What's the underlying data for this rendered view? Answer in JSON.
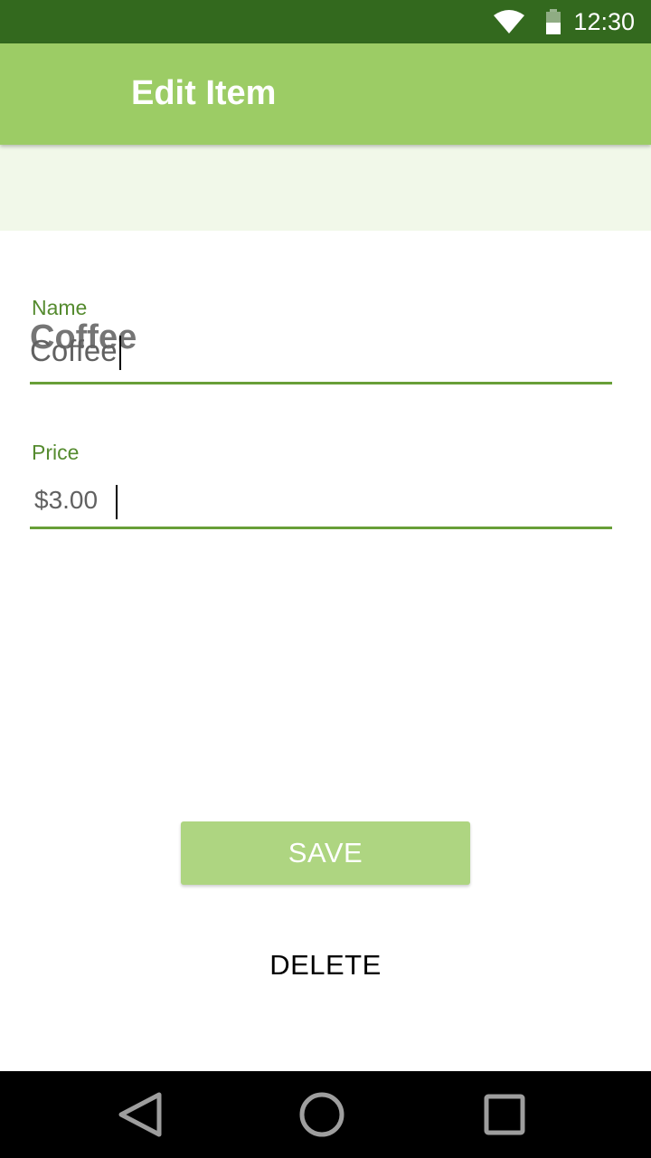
{
  "status_bar": {
    "time": "12:30",
    "icons": [
      "wifi-icon",
      "battery-icon"
    ]
  },
  "app_bar": {
    "title": "Edit Item"
  },
  "header": {
    "item_name": "Coffee"
  },
  "form": {
    "name": {
      "label": "Name",
      "value": "Coffee"
    },
    "price": {
      "label": "Price",
      "value": "$3.00"
    }
  },
  "actions": {
    "save_label": "SAVE",
    "delete_label": "DELETE"
  },
  "nav_bar": {
    "icons": [
      "back-icon",
      "home-icon",
      "recents-icon"
    ]
  },
  "colors": {
    "status_bar": "#33691e",
    "app_bar": "#9ccc65",
    "header_band": "#f1f8e9",
    "accent": "#558b2f",
    "save_button": "#aed581"
  }
}
